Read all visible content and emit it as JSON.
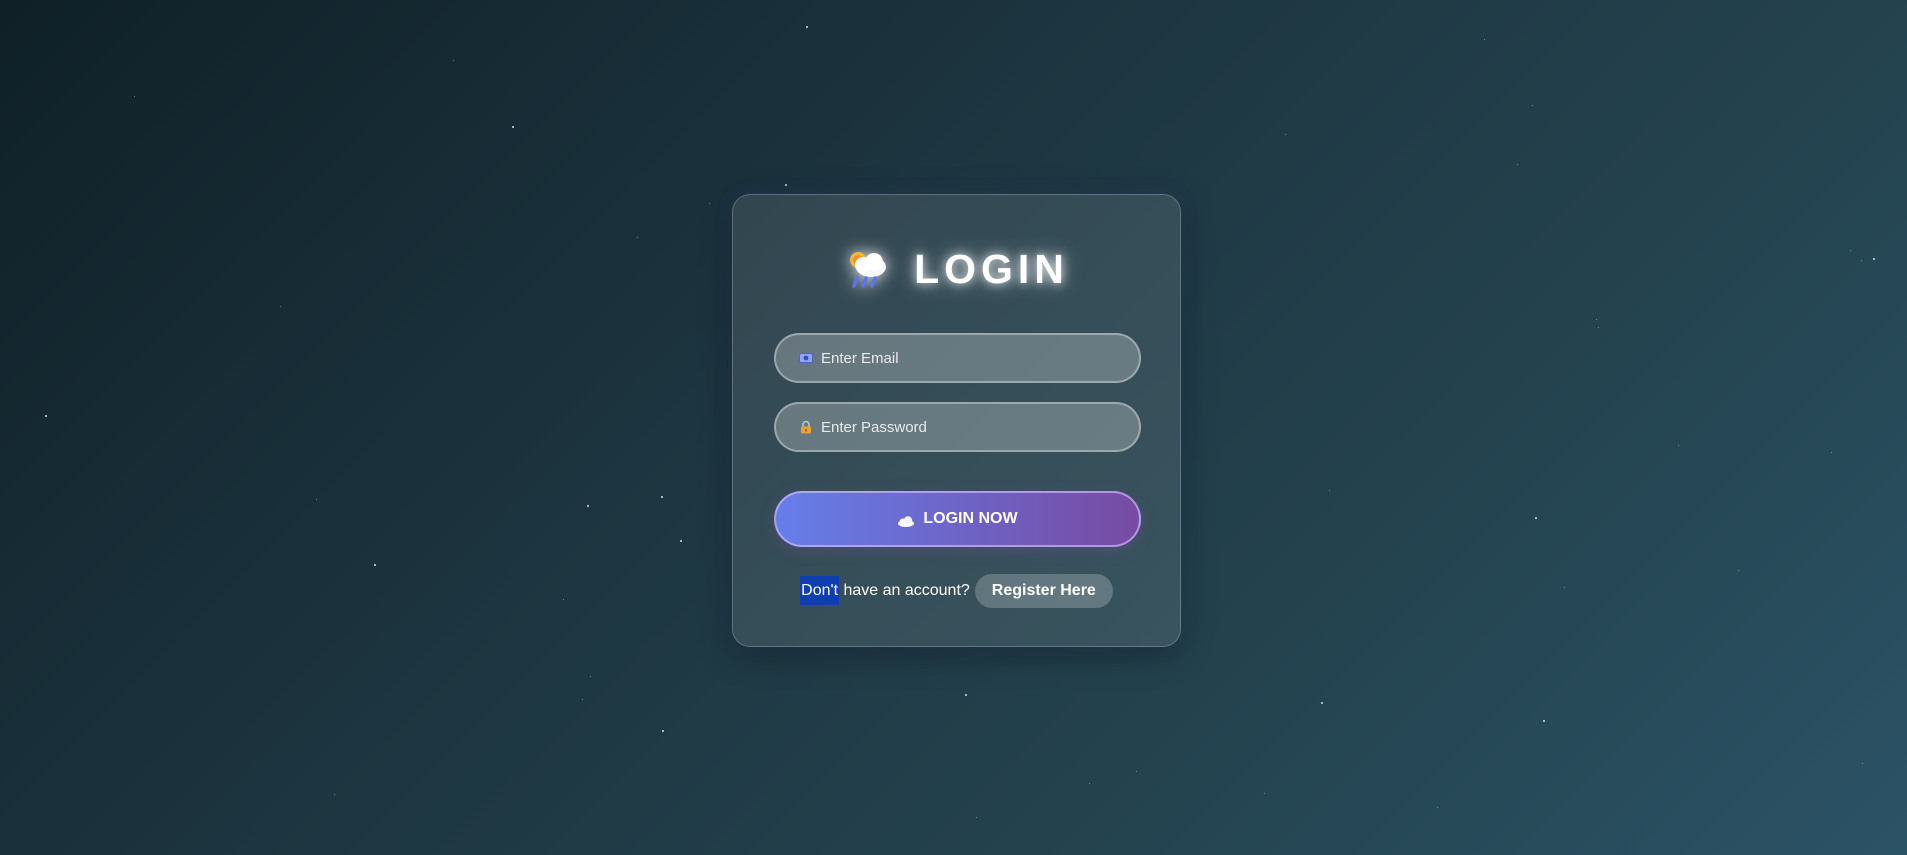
{
  "page": {
    "title": "LOGIN",
    "title_icon": "cloud-sun-rain-icon"
  },
  "form": {
    "email": {
      "icon": "id-card-icon",
      "placeholder": "Enter Email",
      "value": ""
    },
    "password": {
      "icon": "lock-icon",
      "placeholder": "Enter Password",
      "value": ""
    },
    "submit": {
      "icon": "cloud-icon",
      "label": "LOGIN NOW"
    }
  },
  "footer": {
    "prompt_selected": "Don't",
    "prompt_rest": " have an account?",
    "register_label": "Register Here"
  },
  "colors": {
    "accent_start": "#667eea",
    "accent_end": "#764ba2",
    "background_dark": "#0f2027",
    "background_light": "#2b5366",
    "text_selection": "#0f3fae"
  }
}
